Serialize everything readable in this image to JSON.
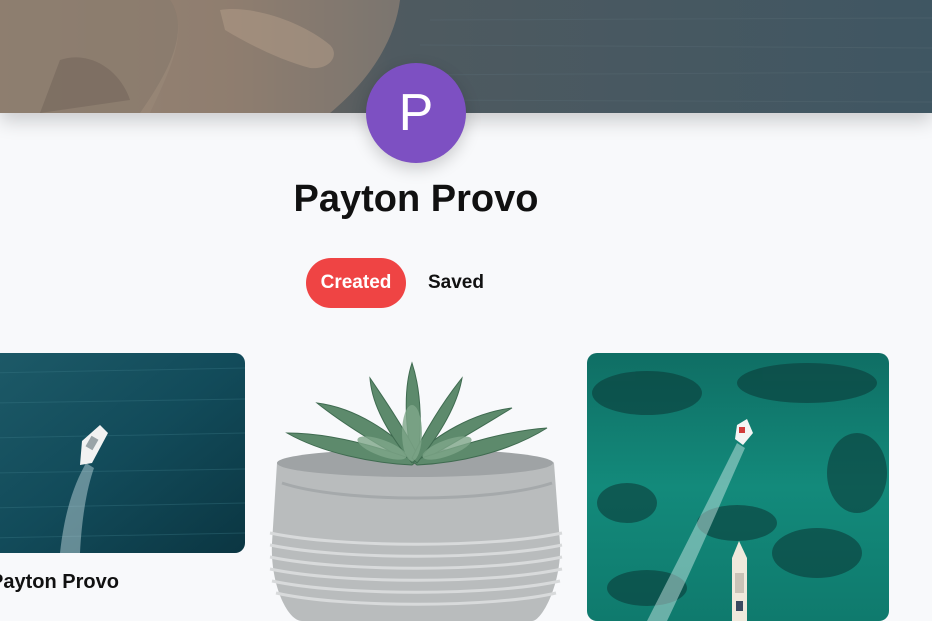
{
  "profile": {
    "avatar_initial": "P",
    "name": "Payton Provo"
  },
  "tabs": [
    {
      "label": "Created",
      "active": true
    },
    {
      "label": "Saved",
      "active": false
    }
  ],
  "pins": [
    {
      "image": "aerial-boat-dark-sea",
      "title": "Payton Provo"
    },
    {
      "image": "succulent-concrete-pot",
      "title": ""
    },
    {
      "image": "aerial-boats-turquoise-sea",
      "title": ""
    }
  ],
  "colors": {
    "avatar_bg": "#7d50c2",
    "active_tab_bg": "#ef4444",
    "page_bg": "#f8f9fb"
  }
}
